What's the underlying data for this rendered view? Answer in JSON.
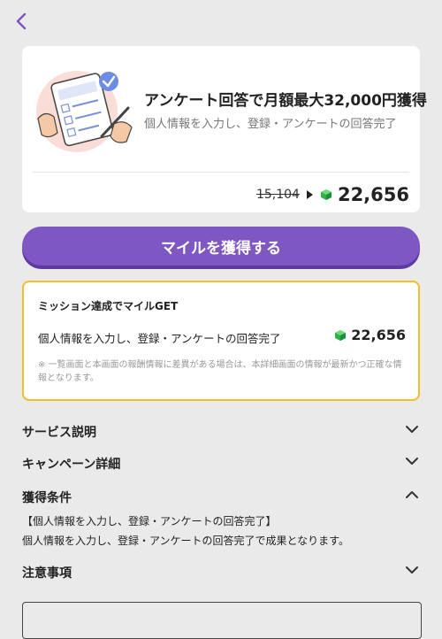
{
  "header": {
    "back_icon": "chevron-left-icon"
  },
  "offer": {
    "title": "アンケート回答で月額最大32,000円獲得",
    "subtitle": "個人情報を入力し、登録・アンケートの回答完了",
    "old_points": "15,104",
    "new_points": "22,656"
  },
  "cta": {
    "label": "マイルを獲得する"
  },
  "mission": {
    "title": "ミッション達成でマイルGET",
    "task": "個人情報を入力し、登録・アンケートの回答完了",
    "reward": "22,656",
    "note": "※ 一覧画面と本画面の報酬情報に差異がある場合は、本詳細画面の情報が最新かつ正確な情報となります。"
  },
  "sections": {
    "service": "サービス説明",
    "campaign": "キャンペーン詳細",
    "conditions": "獲得条件",
    "notes": "注意事項"
  },
  "conditions_detail": {
    "line1": "【個人情報を入力し、登録・アンケートの回答完了】",
    "line2": "個人情報を入力し、登録・アンケートの回答完了で成果となります。"
  },
  "colors": {
    "accent": "#7e57c2",
    "mission_border": "#f2c024",
    "gem": "#2fb34a"
  }
}
